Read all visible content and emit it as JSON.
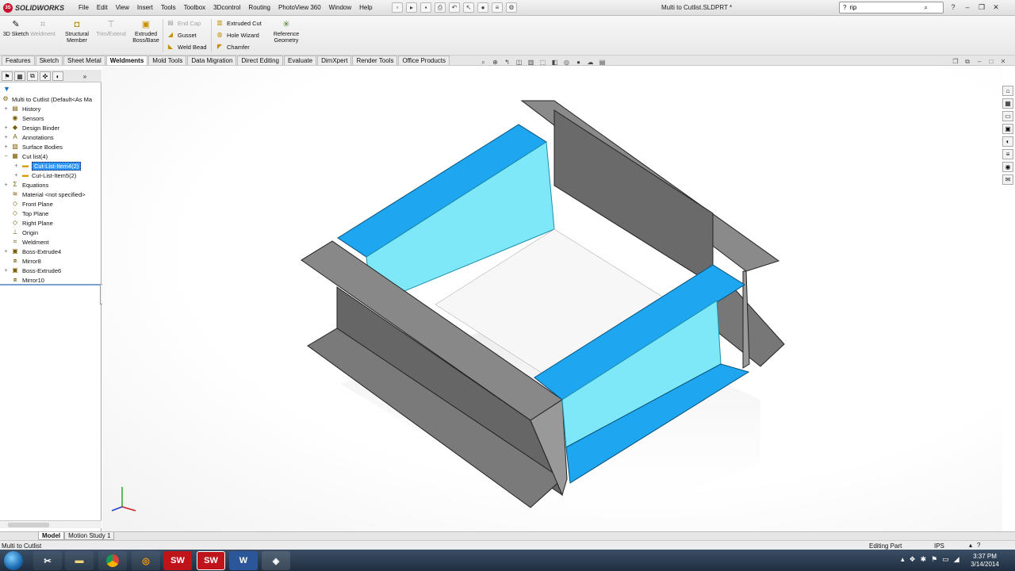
{
  "app": {
    "logo_text": "SOLIDWORKS",
    "ds_mark": "3S",
    "doc_title": "Multi to Cutlist.SLDPRT *"
  },
  "menu": [
    "File",
    "Edit",
    "View",
    "Insert",
    "Tools",
    "Toolbox",
    "3Dcontrol",
    "Routing",
    "PhotoView 360",
    "Window",
    "Help"
  ],
  "search": {
    "value": "rip"
  },
  "toolbar": {
    "sketch3d": "3D Sketch",
    "weldment": "Weldment",
    "structural": "Structural Member",
    "trim": "Trim/Extend",
    "extruded_boss": "Extruded Boss/Base",
    "end_cap": "End Cap",
    "gusset": "Gusset",
    "weld_bead": "Weld Bead",
    "extruded_cut": "Extruded Cut",
    "hole_wizard": "Hole Wizard",
    "chamfer": "Chamfer",
    "reference_geometry": "Reference Geometry"
  },
  "tabs": [
    "Features",
    "Sketch",
    "Sheet Metal",
    "Weldments",
    "Mold Tools",
    "Data Migration",
    "Direct Editing",
    "Evaluate",
    "DimXpert",
    "Render Tools",
    "Office Products"
  ],
  "active_tab": "Weldments",
  "tree": {
    "root": "Multi to Cutlist  (Default<As Ma",
    "history": "History",
    "sensors": "Sensors",
    "design_binder": "Design Binder",
    "annotations": "Annotations",
    "surface_bodies": "Surface Bodies",
    "cut_list": "Cut list(4)",
    "cut_item4": "Cut-List-Item4(2)",
    "cut_item5": "Cut-List-Item5(2)",
    "equations": "Equations",
    "material": "Material <not specified>",
    "front_plane": "Front Plane",
    "top_plane": "Top Plane",
    "right_plane": "Right Plane",
    "origin": "Origin",
    "weldment": "Weldment",
    "boss_extrude4": "Boss-Extrude4",
    "mirror8": "Mirror8",
    "boss_extrude6": "Boss-Extrude6",
    "mirror10": "Mirror10"
  },
  "bottom_tabs": [
    "Model",
    "Motion Study 1"
  ],
  "status": {
    "left": "Multi to Cutlist",
    "mode": "Editing Part",
    "units": "IPS"
  },
  "clock": {
    "time": "3:37 PM",
    "date": "3/14/2014"
  },
  "taskbar": {
    "sw_label": "SW",
    "word_label": "W"
  },
  "colors": {
    "highlight": "#1ea7f0",
    "steel": "#6e6e6e",
    "selection": "#3399ff"
  }
}
